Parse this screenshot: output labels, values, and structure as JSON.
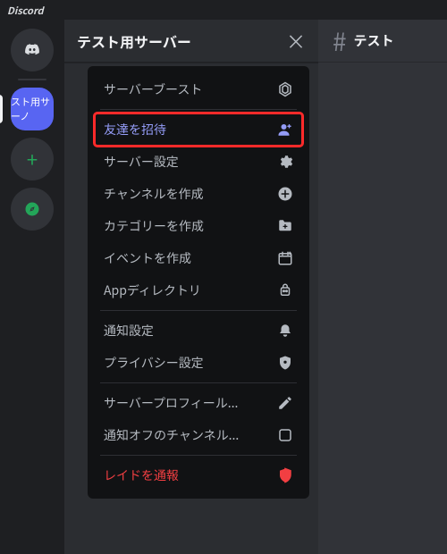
{
  "titlebar": "Discord",
  "rail": {
    "home_icon": "discord-logo",
    "selected_server_label": "スト用サーノ",
    "add_tooltip": "+",
    "explore_icon": "compass"
  },
  "server": {
    "name": "テスト用サーバー",
    "close_icon": "×"
  },
  "channel": {
    "hash": "#",
    "name": "テスト"
  },
  "menu": {
    "items": [
      {
        "label": "サーバーブースト",
        "icon": "boost-icon",
        "kind": "normal"
      },
      {
        "label": "友達を招待",
        "icon": "invite-people-icon",
        "kind": "accent",
        "highlight": true
      },
      {
        "label": "サーバー設定",
        "icon": "gear-icon",
        "kind": "normal"
      },
      {
        "label": "チャンネルを作成",
        "icon": "plus-circle-icon",
        "kind": "normal"
      },
      {
        "label": "カテゴリーを作成",
        "icon": "folder-plus-icon",
        "kind": "normal"
      },
      {
        "label": "イベントを作成",
        "icon": "calendar-plus-icon",
        "kind": "normal"
      },
      {
        "label": "Appディレクトリ",
        "icon": "app-directory-icon",
        "kind": "normal"
      },
      {
        "label": "通知設定",
        "icon": "bell-icon",
        "kind": "normal"
      },
      {
        "label": "プライバシー設定",
        "icon": "shield-icon",
        "kind": "normal"
      },
      {
        "label": "サーバープロフィール...",
        "icon": "pencil-icon",
        "kind": "normal"
      },
      {
        "label": "通知オフのチャンネル...",
        "icon": "checkbox-empty-icon",
        "kind": "normal"
      },
      {
        "label": "レイドを通報",
        "icon": "report-shield-icon",
        "kind": "danger"
      }
    ]
  }
}
